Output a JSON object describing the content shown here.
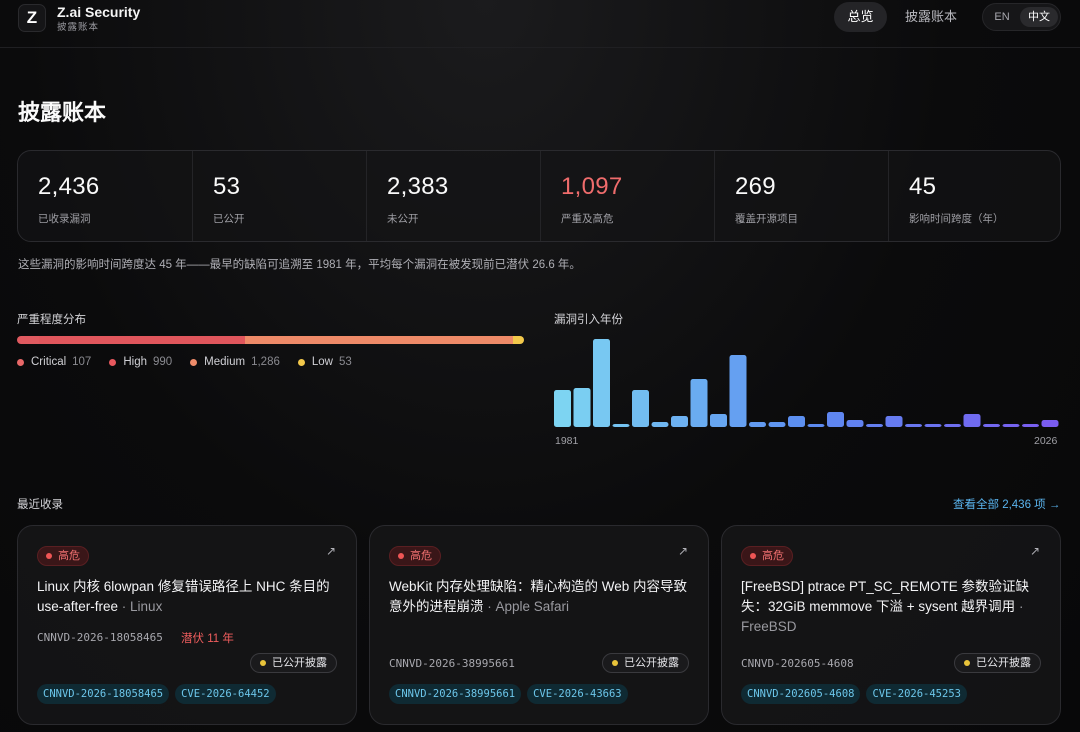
{
  "header": {
    "logo_letter": "Z",
    "brand_title": "Z.ai Security",
    "brand_subtitle": "披露账本",
    "nav": [
      {
        "label": "总览",
        "active": true
      },
      {
        "label": "披露账本",
        "active": false
      }
    ],
    "lang": [
      {
        "label": "EN",
        "active": false
      },
      {
        "label": "中文",
        "active": true
      }
    ]
  },
  "page_title": "披露账本",
  "stats": [
    {
      "value": "2,436",
      "label": "已收录漏洞",
      "highlight": false
    },
    {
      "value": "53",
      "label": "已公开",
      "highlight": false
    },
    {
      "value": "2,383",
      "label": "未公开",
      "highlight": false
    },
    {
      "value": "1,097",
      "label": "严重及高危",
      "highlight": true
    },
    {
      "value": "269",
      "label": "覆盖开源项目",
      "highlight": false
    },
    {
      "value": "45",
      "label": "影响时间跨度（年）",
      "highlight": false
    }
  ],
  "summary": "这些漏洞的影响时间跨度达 45 年——最早的缺陷可追溯至 1981 年，平均每个漏洞在被发现前已潜伏 26.6 年。",
  "severity": {
    "title": "严重程度分布",
    "items": [
      {
        "name": "Critical",
        "count": "107",
        "value": 107,
        "color": "#e05a60"
      },
      {
        "name": "High",
        "count": "990",
        "value": 990,
        "color": "#e0565c"
      },
      {
        "name": "Medium",
        "count": "1,286",
        "value": 1286,
        "color": "#ee8a68"
      },
      {
        "name": "Low",
        "count": "53",
        "value": 53,
        "color": "#f2c84b"
      }
    ]
  },
  "chart_data": {
    "type": "bar",
    "title": "漏洞引入年份",
    "x_start_label": "1981",
    "x_end_label": "2026",
    "values": [
      37,
      39,
      88,
      3,
      37,
      5,
      11,
      48,
      13,
      72,
      5,
      5,
      11,
      3,
      15,
      7,
      3,
      11,
      3,
      3,
      3,
      13,
      3,
      3,
      3,
      7
    ],
    "ylim": [
      0,
      88
    ]
  },
  "recent": {
    "title": "最近收录",
    "view_all": "查看全部 2,436 项 →",
    "cards": [
      {
        "severity": "高危",
        "title": "Linux 内核 6lowpan 修复错误路径上 NHC 条目的 use-after-free",
        "vendor": " · Linux",
        "id": "CNNVD-2026-18058465",
        "latency": "潜伏 11 年",
        "status": "已公开披露",
        "tags": [
          "CNNVD-2026-18058465",
          "CVE-2026-64452"
        ]
      },
      {
        "severity": "高危",
        "title": "WebKit 内存处理缺陷：精心构造的 Web 内容导致意外的进程崩溃",
        "vendor": " · Apple Safari",
        "id": "CNNVD-2026-38995661",
        "latency": "",
        "status": "已公开披露",
        "tags": [
          "CNNVD-2026-38995661",
          "CVE-2026-43663"
        ]
      },
      {
        "severity": "高危",
        "title": "[FreeBSD] ptrace PT_SC_REMOTE 参数验证缺失：32GiB memmove 下溢 + sysent 越界调用",
        "vendor": " · FreeBSD",
        "id": "CNNVD-202605-4608",
        "latency": "",
        "status": "已公开披露",
        "tags": [
          "CNNVD-202605-4608",
          "CVE-2026-45253"
        ]
      }
    ]
  }
}
